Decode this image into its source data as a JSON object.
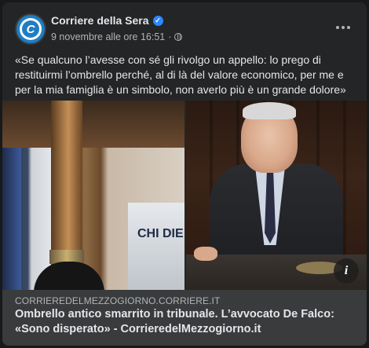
{
  "post": {
    "page_name": "Corriere della Sera",
    "avatar_letter": "C",
    "verified_icon": "check-icon",
    "timestamp": "9 novembre alle ore 16:51",
    "separator": "·",
    "audience_icon": "globe-icon",
    "more_icon": "more-options-icon",
    "text": "«Se qualcuno l’avesse con sé gli rivolgo un appello: lo prego di restituirmi l’ombrello perché, al di là del valore economico, per me e per la mia famiglia è un simbolo, non averlo più è un grande dolore»"
  },
  "image": {
    "bag_text": "CHI DIE",
    "info_icon": "info-icon",
    "info_glyph": "i"
  },
  "link": {
    "domain": "CORRIEREDELMEZZOGIORNO.CORRIERE.IT",
    "headline": "Ombrello antico smarrito in tribunale. L’avvocato De Falco: «Sono disperato» - CorrieredelMezzogiorno.it"
  },
  "colors": {
    "card_bg": "#242526",
    "page_bg": "#18191a",
    "link_bg": "#3a3b3c",
    "brand_blue": "#1f7ec3",
    "verified_blue": "#2d88ff"
  }
}
